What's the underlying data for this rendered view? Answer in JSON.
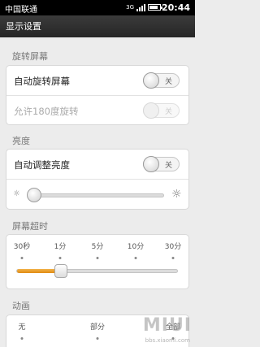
{
  "status_bar": {
    "carrier": "中国联通",
    "network": "3G",
    "signal_bars": 4,
    "battery_level": 0.8,
    "time": "20:44"
  },
  "title": "显示设置",
  "sections": {
    "rotation": {
      "header": "旋转屏幕",
      "auto_rotate": {
        "label": "自动旋转屏幕",
        "state": "关",
        "enabled": true,
        "on": false
      },
      "allow_180": {
        "label": "允许180度旋转",
        "state": "关",
        "enabled": false,
        "on": false
      }
    },
    "brightness": {
      "header": "亮度",
      "auto_brightness": {
        "label": "自动调整亮度",
        "state": "关",
        "enabled": true,
        "on": false
      },
      "level": 0.0,
      "low_icon": "sun-dim-icon",
      "high_icon": "sun-bright-icon"
    },
    "timeout": {
      "header": "屏幕超时",
      "options": [
        "30秒",
        "1分",
        "5分",
        "10分",
        "30分"
      ],
      "selected_index": 1
    },
    "animation": {
      "header": "动画",
      "options": [
        "无",
        "部分",
        "全部"
      ]
    }
  },
  "watermark": {
    "brand": "MIUI",
    "url": "bbs.xiaomi.com"
  },
  "colors": {
    "accent": "#e8961e",
    "title_bar": "#2e2e2e",
    "background": "#ececec"
  }
}
